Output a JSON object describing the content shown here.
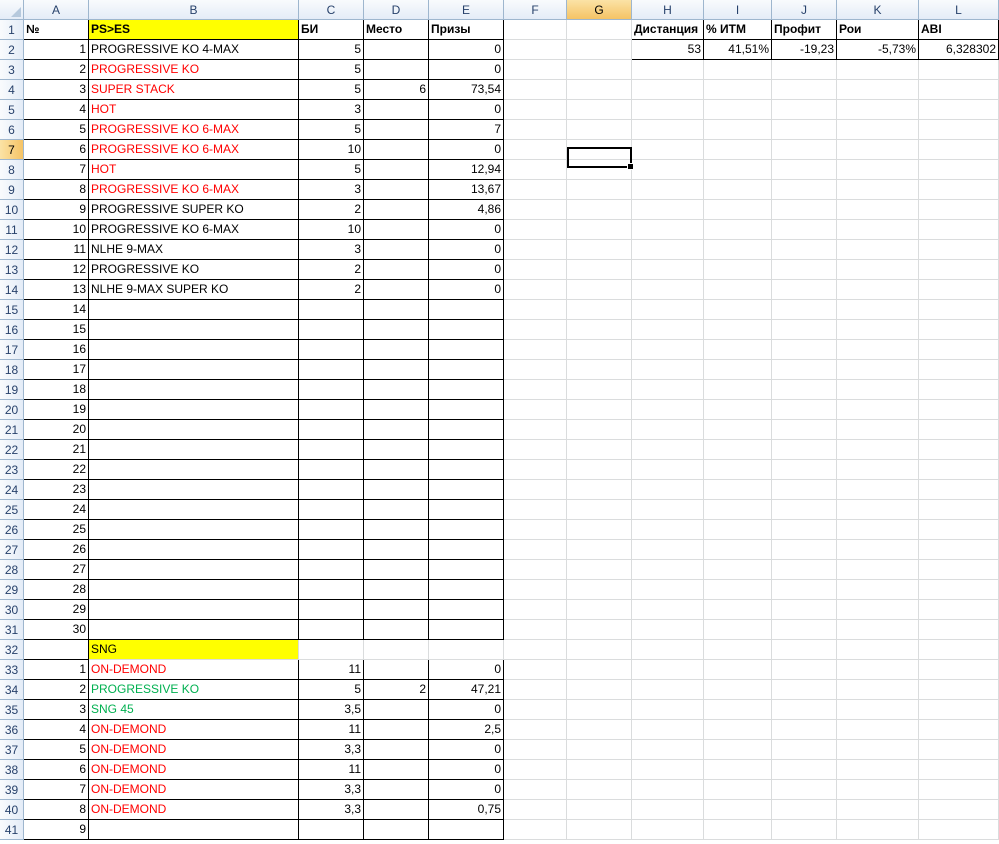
{
  "sheet": {
    "columns": [
      "A",
      "B",
      "C",
      "D",
      "E",
      "F",
      "G",
      "H",
      "I",
      "J",
      "K",
      "L"
    ],
    "selected_column": "G",
    "selected_row": 7,
    "header_row": {
      "no": "№",
      "section": "PS>ES",
      "bi": "БИ",
      "place": "Место",
      "prizes": "Призы"
    },
    "stats": {
      "headers": [
        "Дистанция",
        "% ИТМ",
        "Профит",
        "Рои",
        "ABI"
      ],
      "values": [
        "53",
        "41,51%",
        "-19,23",
        "-5,73%",
        "6,328302"
      ]
    },
    "ps_rows": [
      {
        "n": "1",
        "name": "PROGRESSIVE KO 4-MAX",
        "color": "black",
        "bi": "5",
        "place": "",
        "prize": "0"
      },
      {
        "n": "2",
        "name": "PROGRESSIVE KO",
        "color": "red",
        "bi": "5",
        "place": "",
        "prize": "0"
      },
      {
        "n": "3",
        "name": "SUPER STACK",
        "color": "red",
        "bi": "5",
        "place": "6",
        "prize": "73,54"
      },
      {
        "n": "4",
        "name": "HOT",
        "color": "red",
        "bi": "3",
        "place": "",
        "prize": "0"
      },
      {
        "n": "5",
        "name": "PROGRESSIVE KO 6-MAX",
        "color": "red",
        "bi": "5",
        "place": "",
        "prize": "7"
      },
      {
        "n": "6",
        "name": "PROGRESSIVE KO 6-MAX",
        "color": "red",
        "bi": "10",
        "place": "",
        "prize": "0"
      },
      {
        "n": "7",
        "name": "HOT",
        "color": "red",
        "bi": "5",
        "place": "",
        "prize": "12,94"
      },
      {
        "n": "8",
        "name": "PROGRESSIVE KO 6-MAX",
        "color": "red",
        "bi": "3",
        "place": "",
        "prize": "13,67"
      },
      {
        "n": "9",
        "name": "PROGRESSIVE SUPER KO",
        "color": "black",
        "bi": "2",
        "place": "",
        "prize": "4,86"
      },
      {
        "n": "10",
        "name": "PROGRESSIVE KO 6-MAX",
        "color": "black",
        "bi": "10",
        "place": "",
        "prize": "0"
      },
      {
        "n": "11",
        "name": "NLHE 9-MAX",
        "color": "black",
        "bi": "3",
        "place": "",
        "prize": "0"
      },
      {
        "n": "12",
        "name": "PROGRESSIVE KO",
        "color": "black",
        "bi": "2",
        "place": "",
        "prize": "0"
      },
      {
        "n": "13",
        "name": "NLHE 9-MAX SUPER KO",
        "color": "black",
        "bi": "2",
        "place": "",
        "prize": "0"
      },
      {
        "n": "14",
        "name": "",
        "color": "black",
        "bi": "",
        "place": "",
        "prize": ""
      },
      {
        "n": "15",
        "name": "",
        "color": "black",
        "bi": "",
        "place": "",
        "prize": ""
      },
      {
        "n": "16",
        "name": "",
        "color": "black",
        "bi": "",
        "place": "",
        "prize": ""
      },
      {
        "n": "17",
        "name": "",
        "color": "black",
        "bi": "",
        "place": "",
        "prize": ""
      },
      {
        "n": "18",
        "name": "",
        "color": "black",
        "bi": "",
        "place": "",
        "prize": ""
      },
      {
        "n": "19",
        "name": "",
        "color": "black",
        "bi": "",
        "place": "",
        "prize": ""
      },
      {
        "n": "20",
        "name": "",
        "color": "black",
        "bi": "",
        "place": "",
        "prize": ""
      },
      {
        "n": "21",
        "name": "",
        "color": "black",
        "bi": "",
        "place": "",
        "prize": ""
      },
      {
        "n": "22",
        "name": "",
        "color": "black",
        "bi": "",
        "place": "",
        "prize": ""
      },
      {
        "n": "23",
        "name": "",
        "color": "black",
        "bi": "",
        "place": "",
        "prize": ""
      },
      {
        "n": "24",
        "name": "",
        "color": "black",
        "bi": "",
        "place": "",
        "prize": ""
      },
      {
        "n": "25",
        "name": "",
        "color": "black",
        "bi": "",
        "place": "",
        "prize": ""
      },
      {
        "n": "26",
        "name": "",
        "color": "black",
        "bi": "",
        "place": "",
        "prize": ""
      },
      {
        "n": "27",
        "name": "",
        "color": "black",
        "bi": "",
        "place": "",
        "prize": ""
      },
      {
        "n": "28",
        "name": "",
        "color": "black",
        "bi": "",
        "place": "",
        "prize": ""
      },
      {
        "n": "29",
        "name": "",
        "color": "black",
        "bi": "",
        "place": "",
        "prize": ""
      },
      {
        "n": "30",
        "name": "",
        "color": "black",
        "bi": "",
        "place": "",
        "prize": ""
      }
    ],
    "sng_label": "SNG",
    "sng_rows": [
      {
        "n": "1",
        "name": "ON-DEMOND",
        "color": "red",
        "bi": "11",
        "place": "",
        "prize": "0"
      },
      {
        "n": "2",
        "name": "PROGRESSIVE KO",
        "color": "green",
        "bi": "5",
        "place": "2",
        "prize": "47,21"
      },
      {
        "n": "3",
        "name": "SNG 45",
        "color": "green",
        "bi": "3,5",
        "place": "",
        "prize": "0"
      },
      {
        "n": "4",
        "name": "ON-DEMOND",
        "color": "red",
        "bi": "11",
        "place": "",
        "prize": "2,5"
      },
      {
        "n": "5",
        "name": "ON-DEMOND",
        "color": "red",
        "bi": "3,3",
        "place": "",
        "prize": "0"
      },
      {
        "n": "6",
        "name": "ON-DEMOND",
        "color": "red",
        "bi": "11",
        "place": "",
        "prize": "0"
      },
      {
        "n": "7",
        "name": "ON-DEMOND",
        "color": "red",
        "bi": "3,3",
        "place": "",
        "prize": "0"
      },
      {
        "n": "8",
        "name": "ON-DEMOND",
        "color": "red",
        "bi": "3,3",
        "place": "",
        "prize": "0,75"
      },
      {
        "n": "9",
        "name": "",
        "color": "black",
        "bi": "",
        "place": "",
        "prize": ""
      }
    ],
    "row_count": 41
  }
}
